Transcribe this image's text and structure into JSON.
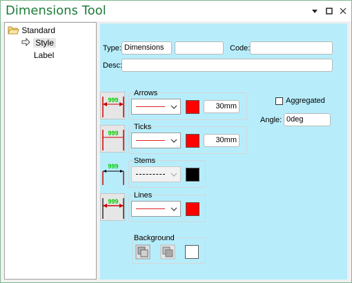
{
  "window": {
    "title": "Dimensions Tool"
  },
  "titlebar_icons": [
    "dropdown-arrow-icon",
    "maximize-icon",
    "close-icon"
  ],
  "tree": {
    "root_label": "Standard",
    "items": [
      {
        "label": "Style",
        "selected": true
      },
      {
        "label": "Label",
        "selected": false
      }
    ]
  },
  "form": {
    "type_label": "Type:",
    "type_value": "Dimensions",
    "type_extra_value": "",
    "code_label": "Code:",
    "code_value": "",
    "desc_label": "Desc:",
    "desc_value": ""
  },
  "preview_text": "999",
  "groups": {
    "arrows": {
      "label": "Arrows",
      "line_style": "solid",
      "line_color": "#e02020",
      "color": "#ff0000",
      "size": "30mm"
    },
    "ticks": {
      "label": "Ticks",
      "line_style": "solid",
      "line_color": "#e02020",
      "color": "#ff0000",
      "size": "30mm"
    },
    "stems": {
      "label": "Stems",
      "line_style": "dashed",
      "line_color": "#000000",
      "color": "#000000",
      "disabled": true
    },
    "lines": {
      "label": "Lines",
      "line_style": "solid",
      "line_color": "#e02020",
      "color": "#ff0000"
    },
    "background": {
      "label": "Background",
      "color": "#ffffff"
    }
  },
  "options": {
    "aggregated_label": "Aggregated",
    "aggregated_checked": false,
    "angle_label": "Angle:",
    "angle_value": "0deg"
  },
  "colors": {
    "panel_bg": "#b7edfb",
    "title_color": "#1e7c3a",
    "dimension_text": "#00cc00"
  }
}
